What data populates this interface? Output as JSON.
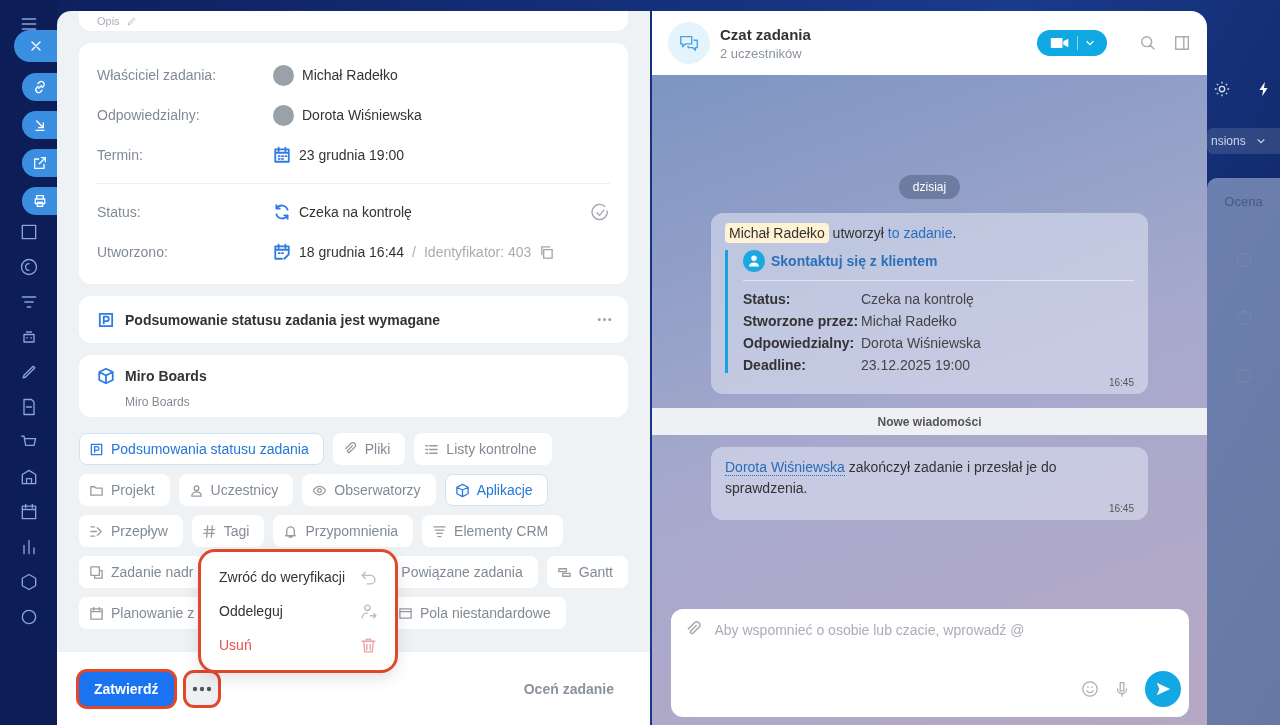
{
  "task": {
    "description_label": "Opis",
    "fields": [
      {
        "kind": "person",
        "label": "Właściciel zadania:",
        "value": "Michał Radełko"
      },
      {
        "kind": "person",
        "label": "Odpowiedzialny:",
        "value": "Dorota Wiśniewska"
      },
      {
        "kind": "deadline",
        "label": "Termin:",
        "value": "23 grudnia 19:00"
      },
      {
        "kind": "status",
        "label": "Status:",
        "value": "Czeka na kontrolę"
      },
      {
        "kind": "created",
        "label": "Utworzono:",
        "value": "18 grudnia 16:44",
        "separator": "/",
        "extra": "Identyfikator: 403"
      }
    ],
    "summary_block": {
      "title": "Podsumowanie statusu zadania jest wymagane"
    },
    "app_block": {
      "title": "Miro Boards",
      "subtitle": "Miro Boards"
    },
    "chip_rows": [
      [
        {
          "kind": "summary",
          "label": "Podsumowania statusu zadania",
          "selected": true
        },
        {
          "kind": "clip",
          "label": "Pliki",
          "selected": false
        },
        {
          "kind": "checklist",
          "label": "Listy kontrolne",
          "selected": false
        }
      ],
      [
        {
          "kind": "folder",
          "label": "Projekt",
          "selected": false
        },
        {
          "kind": "people",
          "label": "Uczestnicy",
          "selected": false
        },
        {
          "kind": "eye",
          "label": "Obserwatorzy",
          "selected": false
        },
        {
          "kind": "apps",
          "label": "Aplikacje",
          "selected": true
        }
      ],
      [
        {
          "kind": "flow",
          "label": "Przepływ",
          "selected": false
        },
        {
          "kind": "tags",
          "label": "Tagi",
          "selected": false
        },
        {
          "kind": "bell",
          "label": "Przypomnienia",
          "selected": false
        },
        {
          "kind": "crm",
          "label": "Elementy CRM",
          "selected": false
        }
      ],
      [
        {
          "kind": "parent",
          "label": "Zadanie nadr",
          "selected": false,
          "cut": true
        },
        {
          "kind": "related",
          "label": "Powiązane zadania",
          "selected": false
        },
        {
          "kind": "gantt",
          "label": "Gantt",
          "selected": false
        }
      ],
      [
        {
          "kind": "planning",
          "label": "Planowanie z",
          "selected": false,
          "cut": true
        },
        {
          "kind": "fields",
          "label": "Pola niestandardowe",
          "selected": false
        }
      ]
    ],
    "menu": {
      "highlighted": true,
      "items": [
        {
          "kind": "return",
          "label": "Zwróć do weryfikacji"
        },
        {
          "kind": "delegate",
          "label": "Oddeleguj"
        },
        {
          "kind": "delete",
          "label": "Usuń"
        }
      ]
    },
    "footer": {
      "primary": {
        "label": "Zatwierdź",
        "highlighted": true
      },
      "more": {
        "highlighted": true
      },
      "rate": "Oceń zadanie"
    }
  },
  "chat": {
    "title": "Czat zadania",
    "subtitle": "2 uczestników",
    "date": "dzisiaj",
    "created_message": {
      "author": "Michał Radełko",
      "verb": "utworzył",
      "link": "to zadanie",
      "end": ".",
      "task_title": "Skontaktuj się z klientem",
      "rows": [
        {
          "label": "Status:",
          "value": "Czeka na kontrolę"
        },
        {
          "label": "Stworzone przez:",
          "value": "Michał Radełko"
        },
        {
          "label": "Odpowiedzialny:",
          "value": "Dorota Wiśniewska"
        },
        {
          "label": "Deadline:",
          "value": "23.12.2025 19:00"
        }
      ],
      "time": "16:45"
    },
    "new_messages": "Nowe wiadomości",
    "done_message": {
      "author": "Dorota Wiśniewska",
      "text": "zakończył zadanie i przesłał je do sprawdzenia.",
      "time": "16:45"
    },
    "input": {
      "placeholder": "Aby wspomnieć o osobie lub czacie, wprowadź @"
    }
  },
  "background": {
    "dropdown": "nsions",
    "column": "Ocena"
  }
}
